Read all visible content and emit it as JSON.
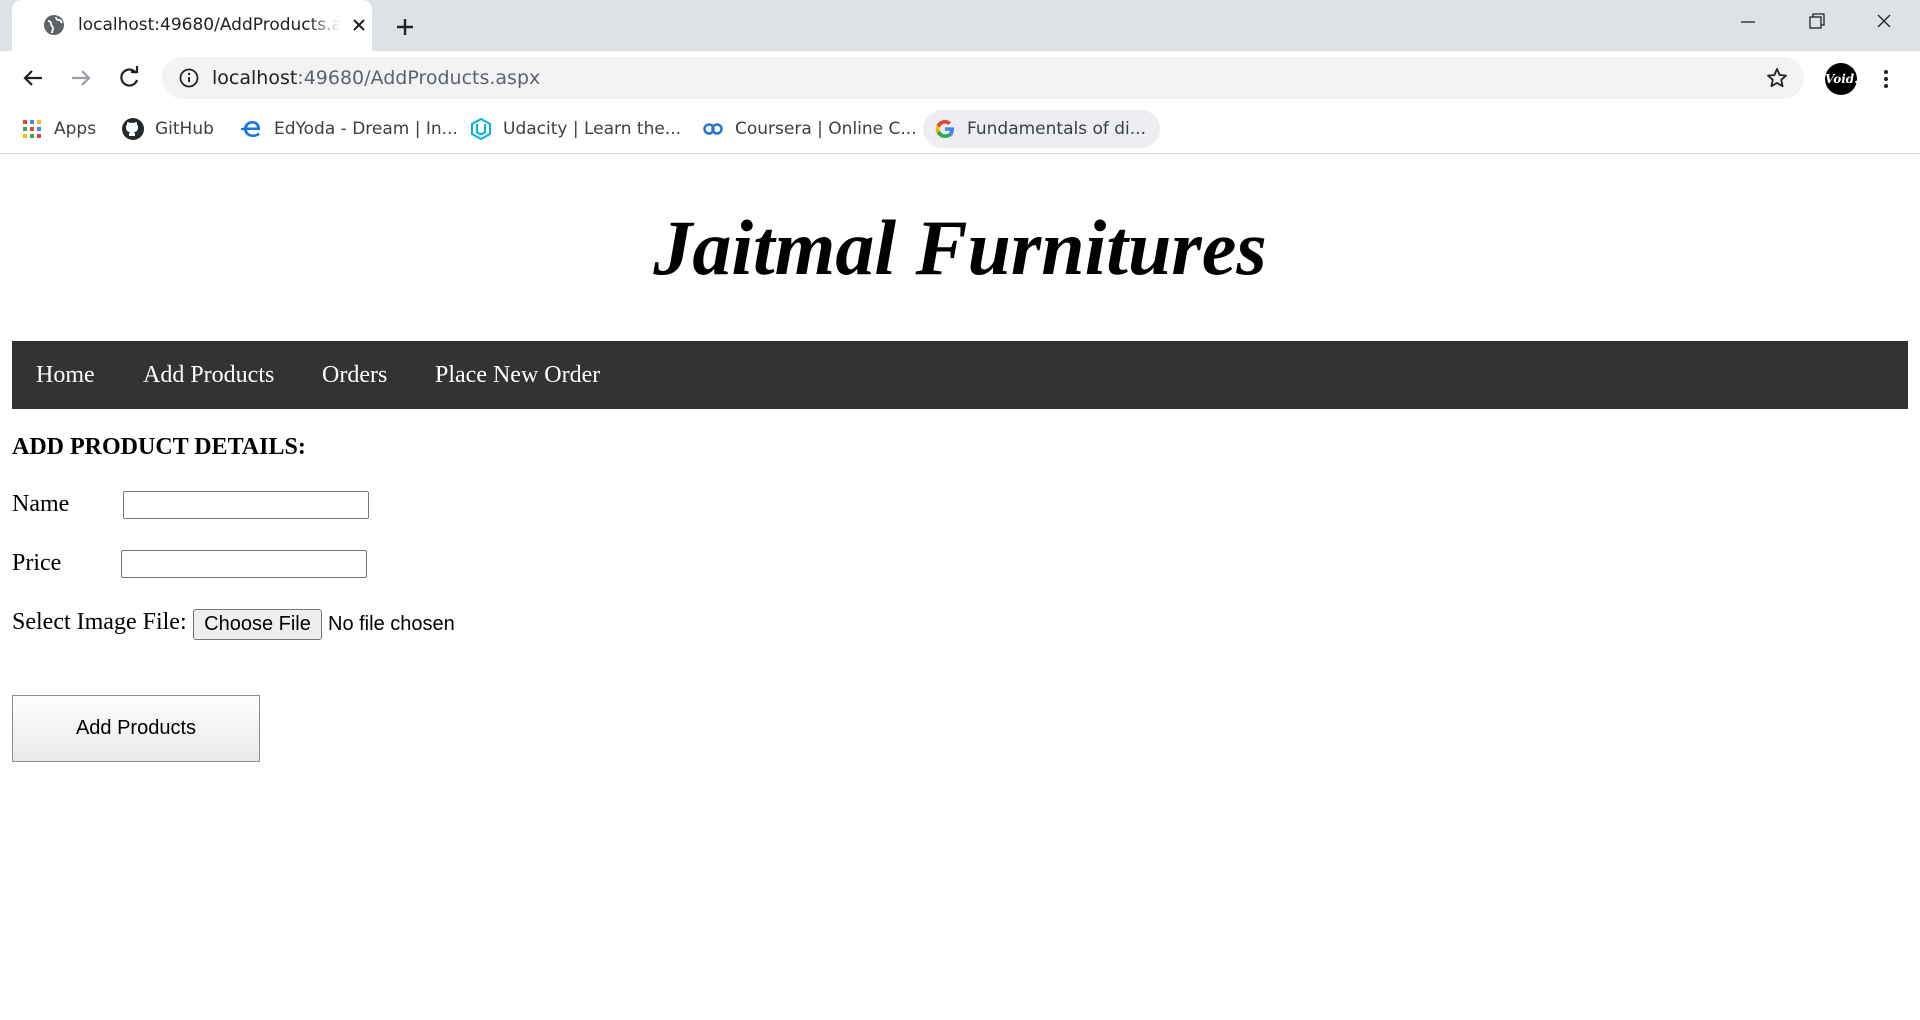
{
  "browser": {
    "tab": {
      "title": "localhost:49680/AddProducts.aspx"
    },
    "address_bar": {
      "host": "localhost",
      "rest": ":49680/AddProducts.aspx"
    },
    "profile_avatar_text": "Void.",
    "bookmarks": [
      {
        "label": "Apps",
        "icon": "apps-grid-icon"
      },
      {
        "label": "GitHub",
        "icon": "github-icon"
      },
      {
        "label": "EdYoda - Dream | In...",
        "icon": "edyoda-icon"
      },
      {
        "label": "Udacity | Learn the...",
        "icon": "udacity-icon"
      },
      {
        "label": "Coursera | Online C...",
        "icon": "coursera-icon"
      },
      {
        "label": "Fundamentals of di...",
        "icon": "google-icon"
      }
    ]
  },
  "site": {
    "title": "Jaitmal Furnitures",
    "nav": [
      {
        "label": "Home"
      },
      {
        "label": "Add Products"
      },
      {
        "label": "Orders"
      },
      {
        "label": "Place New Order"
      }
    ]
  },
  "form": {
    "heading": "ADD PRODUCT DETAILS:",
    "name_label": "Name",
    "name_value": "",
    "price_label": "Price",
    "price_value": "",
    "image_label": "Select Image File:",
    "choose_file_label": "Choose File",
    "file_status": "No file chosen",
    "submit_label": "Add Products"
  },
  "colors": {
    "navbar_bg": "#333333",
    "navbar_text": "#ffffff",
    "tabstrip_bg": "#dee1e6"
  }
}
